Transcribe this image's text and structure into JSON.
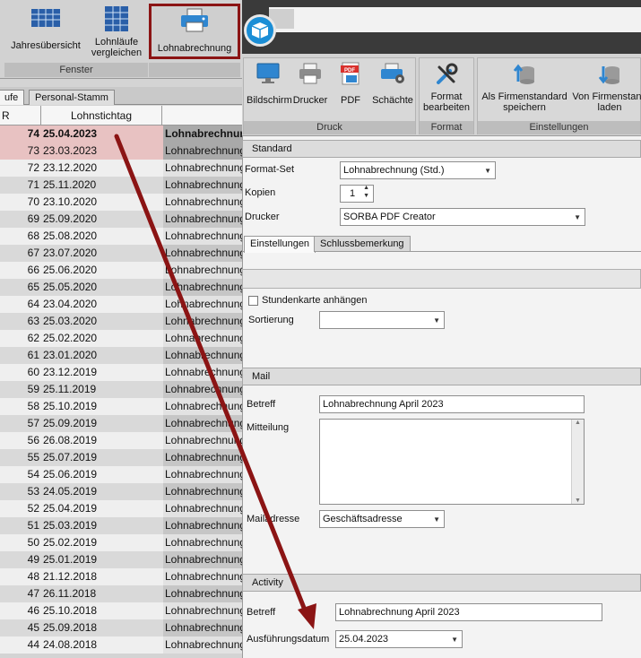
{
  "left_ribbon": {
    "buttons": [
      {
        "label": "Jahresübersicht",
        "icon": "grid-table-icon"
      },
      {
        "label": "Lohnläufe\nvergleichen",
        "icon": "compare-table-icon"
      },
      {
        "label": "Lohnabrechnung",
        "icon": "printer-icon"
      }
    ],
    "group_label": "Fenster"
  },
  "left_tabs": [
    "ufe",
    "Personal-Stamm"
  ],
  "grid": {
    "columns": [
      "R",
      "Lohnstichtag",
      ""
    ],
    "rows": [
      {
        "nr": "74",
        "date": "25.04.2023",
        "label": "Lohnabrechnung"
      },
      {
        "nr": "73",
        "date": "23.03.2023",
        "label": "Lohnabrechnung"
      },
      {
        "nr": "72",
        "date": "23.12.2020",
        "label": "Lohnabrechnung"
      },
      {
        "nr": "71",
        "date": "25.11.2020",
        "label": "Lohnabrechnung"
      },
      {
        "nr": "70",
        "date": "23.10.2020",
        "label": "Lohnabrechnung"
      },
      {
        "nr": "69",
        "date": "25.09.2020",
        "label": "Lohnabrechnung"
      },
      {
        "nr": "68",
        "date": "25.08.2020",
        "label": "Lohnabrechnung"
      },
      {
        "nr": "67",
        "date": "23.07.2020",
        "label": "Lohnabrechnung"
      },
      {
        "nr": "66",
        "date": "25.06.2020",
        "label": "Lohnabrechnung"
      },
      {
        "nr": "65",
        "date": "25.05.2020",
        "label": "Lohnabrechnung"
      },
      {
        "nr": "64",
        "date": "23.04.2020",
        "label": "Lohnabrechnung"
      },
      {
        "nr": "63",
        "date": "25.03.2020",
        "label": "Lohnabrechnung"
      },
      {
        "nr": "62",
        "date": "25.02.2020",
        "label": "Lohnabrechnung"
      },
      {
        "nr": "61",
        "date": "23.01.2020",
        "label": "Lohnabrechnung"
      },
      {
        "nr": "60",
        "date": "23.12.2019",
        "label": "Lohnabrechnung"
      },
      {
        "nr": "59",
        "date": "25.11.2019",
        "label": "Lohnabrechnung"
      },
      {
        "nr": "58",
        "date": "25.10.2019",
        "label": "Lohnabrechnung"
      },
      {
        "nr": "57",
        "date": "25.09.2019",
        "label": "Lohnabrechnung"
      },
      {
        "nr": "56",
        "date": "26.08.2019",
        "label": "Lohnabrechnung"
      },
      {
        "nr": "55",
        "date": "25.07.2019",
        "label": "Lohnabrechnung"
      },
      {
        "nr": "54",
        "date": "25.06.2019",
        "label": "Lohnabrechnung"
      },
      {
        "nr": "53",
        "date": "24.05.2019",
        "label": "Lohnabrechnung"
      },
      {
        "nr": "52",
        "date": "25.04.2019",
        "label": "Lohnabrechnung"
      },
      {
        "nr": "51",
        "date": "25.03.2019",
        "label": "Lohnabrechnung"
      },
      {
        "nr": "50",
        "date": "25.02.2019",
        "label": "Lohnabrechnung"
      },
      {
        "nr": "49",
        "date": "25.01.2019",
        "label": "Lohnabrechnung"
      },
      {
        "nr": "48",
        "date": "21.12.2018",
        "label": "Lohnabrechnung"
      },
      {
        "nr": "47",
        "date": "26.11.2018",
        "label": "Lohnabrechnung"
      },
      {
        "nr": "46",
        "date": "25.10.2018",
        "label": "Lohnabrechnung"
      },
      {
        "nr": "45",
        "date": "25.09.2018",
        "label": "Lohnabrechnung"
      },
      {
        "nr": "44",
        "date": "24.08.2018",
        "label": "Lohnabrechnung"
      }
    ]
  },
  "right_ribbon": {
    "druck": {
      "label": "Druck",
      "buttons": [
        {
          "label": "Bildschirm",
          "icon": "monitor-icon"
        },
        {
          "label": "Drucker",
          "icon": "printer-icon"
        },
        {
          "label": "PDF",
          "icon": "pdf-icon"
        },
        {
          "label": "Schächte",
          "icon": "printer-trays-icon"
        }
      ]
    },
    "format": {
      "label": "Format",
      "buttons": [
        {
          "label": "Format\nbearbeiten",
          "icon": "tools-icon"
        }
      ]
    },
    "einstellungen": {
      "label": "Einstellungen",
      "buttons": [
        {
          "label": "Als Firmenstandard\nspeichern",
          "icon": "db-upload-icon"
        },
        {
          "label": "Von Firmenstand\nladen",
          "icon": "db-download-icon"
        }
      ]
    }
  },
  "standard": {
    "header": "Standard",
    "format_set_label": "Format-Set",
    "format_set_value": "Lohnabrechnung (Std.)",
    "kopien_label": "Kopien",
    "kopien_value": "1",
    "drucker_label": "Drucker",
    "drucker_value": "SORBA PDF Creator"
  },
  "tabs2": [
    "Einstellungen",
    "Schlussbemerkung"
  ],
  "einstellungen": {
    "checkbox_label": "Stundenkarte anhängen",
    "sortierung_label": "Sortierung",
    "sortierung_value": ""
  },
  "mail": {
    "header": "Mail",
    "betreff_label": "Betreff",
    "betreff_value": "Lohnabrechnung April 2023",
    "mitteilung_label": "Mitteilung",
    "mitteilung_value": "",
    "mailadresse_label": "Mailadresse",
    "mailadresse_value": "Geschäftsadresse"
  },
  "activity": {
    "header": "Activity",
    "betreff_label": "Betreff",
    "betreff_value": "Lohnabrechnung April 2023",
    "datum_label": "Ausführungsdatum",
    "datum_value": "25.04.2023"
  },
  "colors": {
    "highlight": "#8b1414",
    "selected_row": "#e8c2c2",
    "app_blue": "#1b8ed6"
  }
}
